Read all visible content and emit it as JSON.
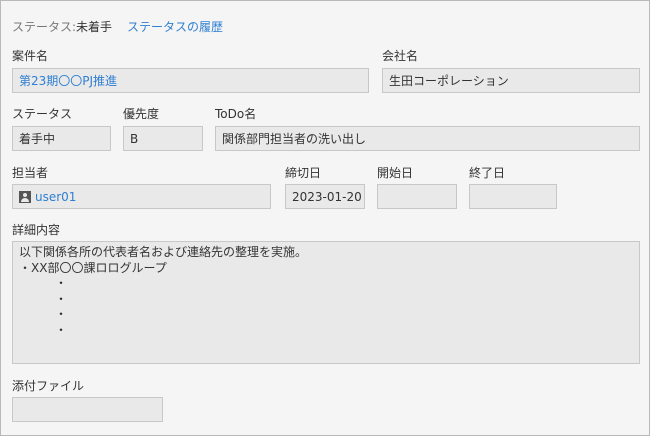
{
  "header": {
    "status_label": "ステータス:",
    "status_value": "未着手",
    "history_link": "ステータスの履歴"
  },
  "fields": {
    "project_name": {
      "label": "案件名",
      "value": "第23期〇〇PJ推進"
    },
    "company_name": {
      "label": "会社名",
      "value": "生田コーポレーション"
    },
    "status": {
      "label": "ステータス",
      "value": "着手中"
    },
    "priority": {
      "label": "優先度",
      "value": "B"
    },
    "todo_name": {
      "label": "ToDo名",
      "value": "関係部門担当者の洗い出し"
    },
    "assignee": {
      "label": "担当者",
      "value": "user01"
    },
    "due_date": {
      "label": "締切日",
      "value": "2023-01-20"
    },
    "start_date": {
      "label": "開始日",
      "value": ""
    },
    "end_date": {
      "label": "終了日",
      "value": ""
    },
    "details": {
      "label": "詳細内容",
      "lines": [
        "以下関係各所の代表者名および連絡先の整理を実施。",
        "・XX部〇〇課ロログループ",
        "　　　・",
        "　　　・",
        "　　　・",
        "　　　・"
      ]
    },
    "attachment": {
      "label": "添付ファイル",
      "value": ""
    }
  }
}
